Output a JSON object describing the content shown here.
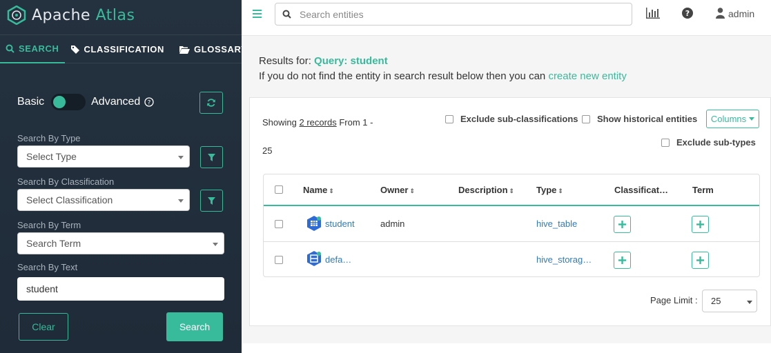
{
  "app": {
    "logo_text_main": "Apache",
    "logo_text_accent": "Atlas"
  },
  "sidebar": {
    "tabs": [
      {
        "label": "SEARCH",
        "icon": "search-icon"
      },
      {
        "label": "CLASSIFICATION",
        "icon": "tag-icon"
      },
      {
        "label": "GLOSSARY",
        "icon": "folder-open-icon"
      }
    ],
    "mode": {
      "basic_label": "Basic",
      "advanced_label": "Advanced"
    },
    "type_label": "Search By Type",
    "type_placeholder": "Select Type",
    "classification_label": "Search By Classification",
    "classification_placeholder": "Select Classification",
    "term_label": "Search By Term",
    "term_placeholder": "Search Term",
    "text_label": "Search By Text",
    "text_value": "student",
    "clear_label": "Clear",
    "search_label": "Search"
  },
  "topbar": {
    "search_placeholder": "Search entities",
    "username": "admin"
  },
  "results": {
    "results_for": "Results for:",
    "query_text": "Query: student",
    "not_found_prefix": "If you do not find the entity in search result below then you can",
    "create_link": "create new entity",
    "showing_prefix": "Showing",
    "records_link": "2 records",
    "from_text": "From 1 -",
    "to_text": "25",
    "exclude_subclass": "Exclude sub-classifications",
    "show_historical": "Show historical entities",
    "exclude_subtypes": "Exclude sub-types",
    "columns_label": "Columns"
  },
  "table": {
    "headers": {
      "name": "Name",
      "owner": "Owner",
      "description": "Description",
      "type": "Type",
      "classification": "Classificat…",
      "term": "Term"
    },
    "rows": [
      {
        "name": "student",
        "owner": "admin",
        "description": "",
        "type": "hive_table"
      },
      {
        "name": "defa…",
        "owner": "",
        "description": "",
        "type": "hive_storag…"
      }
    ]
  },
  "pagination": {
    "label": "Page Limit :",
    "value": "25"
  },
  "colors": {
    "accent": "#37bb9b",
    "sidebar_bg": "#24313f",
    "link": "#337ab7"
  }
}
